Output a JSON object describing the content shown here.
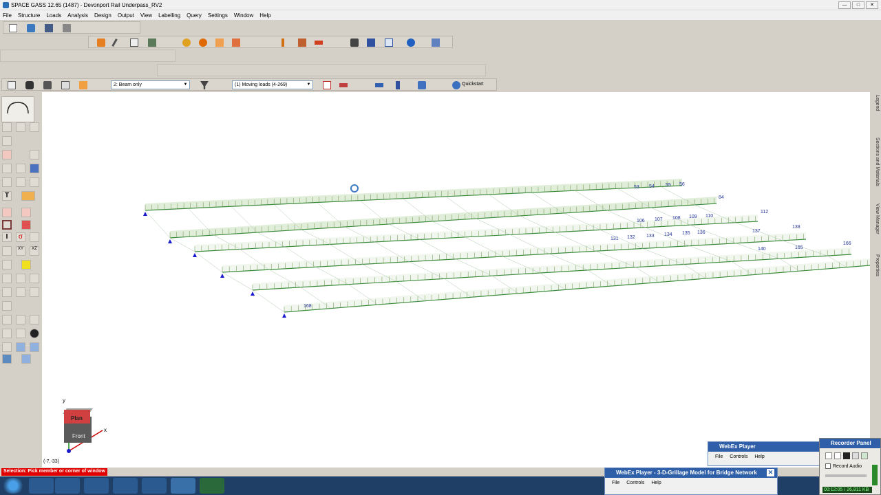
{
  "window": {
    "title": "SPACE GASS 12.65 (1487) - Devonport Rail Underpass_RV2",
    "minimize": "—",
    "maximize": "□",
    "close": "✕"
  },
  "menu": [
    "File",
    "Structure",
    "Loads",
    "Analysis",
    "Design",
    "Output",
    "View",
    "Labelling",
    "Query",
    "Settings",
    "Window",
    "Help"
  ],
  "toolbar": {
    "view_mode": "2: Beam only",
    "load_case": "(1) Moving loads (4-269)",
    "quickstart": "Quickstart"
  },
  "right_tabs": [
    "Legend",
    "Sections and Materials",
    "View Manager",
    "Properties"
  ],
  "viewcube": {
    "top_face": "Plan",
    "front_face": "Front",
    "x_axis": "x",
    "y_axis": "y"
  },
  "coordinates": "(-7,-33)",
  "status": {
    "message": "Selection: Pick member or corner of window"
  },
  "node_labels": [
    "53",
    "54",
    "55",
    "56",
    "84",
    "106",
    "107",
    "108",
    "109",
    "110",
    "112",
    "131",
    "132",
    "133",
    "134",
    "135",
    "136",
    "137",
    "138",
    "140",
    "165",
    "166",
    "168",
    "170"
  ],
  "webex_main": {
    "title": "WebEx Player",
    "menu": [
      "File",
      "Controls",
      "Help"
    ]
  },
  "webex_doc": {
    "title": "WebEx Player - 3-D-Grillage Model for Bridge Network",
    "menu": [
      "File",
      "Controls",
      "Help"
    ]
  },
  "recorder": {
    "title": "Recorder Panel",
    "record_audio": "Record Audio",
    "time": "00:12:05 / 26,811 KB"
  },
  "colors": {
    "member_green": "#3a8a3a",
    "support_blue": "#1a1acc",
    "status_red": "#e00000",
    "taskbar": "#1f3f66"
  }
}
